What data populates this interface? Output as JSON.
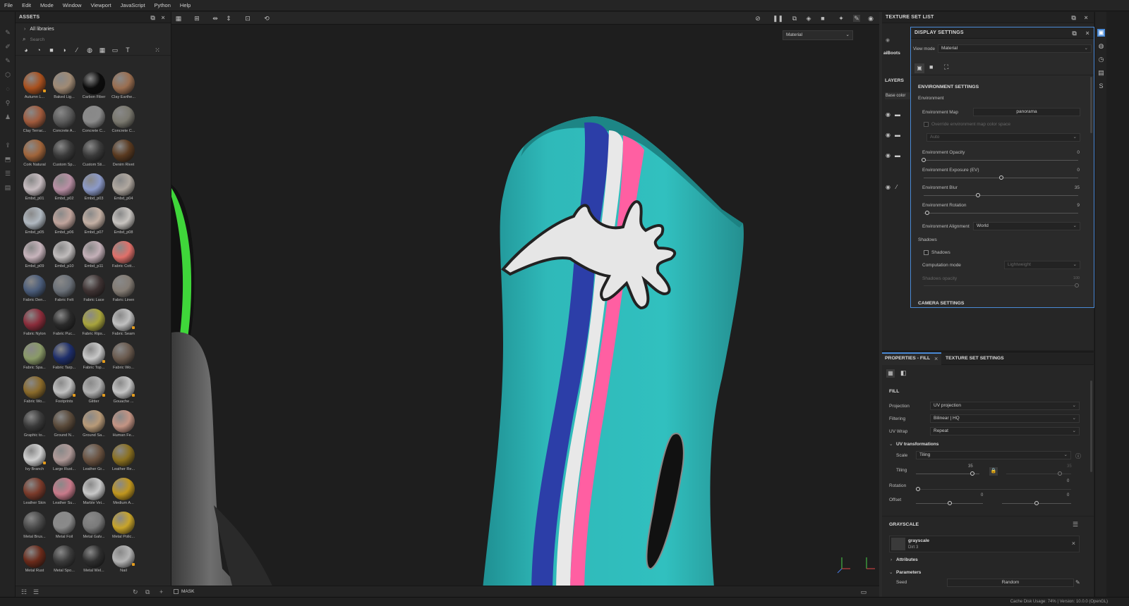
{
  "menu": [
    "File",
    "Edit",
    "Mode",
    "Window",
    "Viewport",
    "JavaScript",
    "Python",
    "Help"
  ],
  "assets": {
    "title": "ASSETS",
    "library": "All libraries",
    "search_placeholder": "Search",
    "items": [
      {
        "label": "Autumn L...",
        "color": "#a8501e",
        "badge": true
      },
      {
        "label": "Baked Lig...",
        "color": "#a08a74",
        "badge": false
      },
      {
        "label": "Carbon Fiber",
        "color": "#0c0c0c",
        "badge": false
      },
      {
        "label": "Clay Earthe...",
        "color": "#9a6e50",
        "badge": false
      },
      {
        "label": "Clay Terrac...",
        "color": "#a05a3c",
        "badge": false
      },
      {
        "label": "Concrete A...",
        "color": "#5a5a5a",
        "badge": false
      },
      {
        "label": "Concrete C...",
        "color": "#8a8a8a",
        "badge": false
      },
      {
        "label": "Concrete C...",
        "color": "#7a786e",
        "badge": false
      },
      {
        "label": "Cork Natural",
        "color": "#a0643a",
        "badge": false
      },
      {
        "label": "Custom Sp...",
        "color": "#3a3a3a",
        "badge": false
      },
      {
        "label": "Custom Sti...",
        "color": "#3a3a3a",
        "badge": false
      },
      {
        "label": "Denim Rivet",
        "color": "#5a3a20",
        "badge": false
      },
      {
        "label": "Embd_p01",
        "color": "#c7bcc0",
        "badge": false
      },
      {
        "label": "Embd_p02",
        "color": "#b88fa4",
        "badge": false
      },
      {
        "label": "Embd_p03",
        "color": "#8c9ac8",
        "badge": false
      },
      {
        "label": "Embd_p04",
        "color": "#b0a8a0",
        "badge": false
      },
      {
        "label": "Embd_p05",
        "color": "#b0b8c0",
        "badge": false
      },
      {
        "label": "Embd_p06",
        "color": "#c0a49c",
        "badge": false
      },
      {
        "label": "Embd_p07",
        "color": "#c4b0a4",
        "badge": false
      },
      {
        "label": "Embd_p08",
        "color": "#c8c4c0",
        "badge": false
      },
      {
        "label": "Embd_p09",
        "color": "#c8b4bc",
        "badge": false
      },
      {
        "label": "Embd_p10",
        "color": "#c0bcbc",
        "badge": false
      },
      {
        "label": "Embd_p11",
        "color": "#c4b0b8",
        "badge": false
      },
      {
        "label": "Fabric Cott...",
        "color": "#e0706a",
        "badge": false
      },
      {
        "label": "Fabric Den...",
        "color": "#4a5c7a",
        "badge": false
      },
      {
        "label": "Fabric Felt",
        "color": "#6a7078",
        "badge": false
      },
      {
        "label": "Fabric Lace",
        "color": "#3e3232",
        "badge": false
      },
      {
        "label": "Fabric Linen",
        "color": "#847c74",
        "badge": false
      },
      {
        "label": "Fabric Nylon",
        "color": "#8a2c3a",
        "badge": false
      },
      {
        "label": "Fabric Puc...",
        "color": "#2a2a2a",
        "badge": false
      },
      {
        "label": "Fabric Rips...",
        "color": "#a8a43c",
        "badge": false
      },
      {
        "label": "Fabric Seam",
        "color": "#c0c0c0",
        "badge": true
      },
      {
        "label": "Fabric Spa...",
        "color": "#8a9a68",
        "badge": false
      },
      {
        "label": "Fabric Tarp...",
        "color": "#1e2e6a",
        "badge": false
      },
      {
        "label": "Fabric Top...",
        "color": "#c8c8c8",
        "badge": true
      },
      {
        "label": "Fabric Wo...",
        "color": "#6a5a4e",
        "badge": false
      },
      {
        "label": "Fabric Wo...",
        "color": "#8a6a2a",
        "badge": false
      },
      {
        "label": "Footprints",
        "color": "#c0c0c0",
        "badge": true
      },
      {
        "label": "Glitter",
        "color": "#b0b0b0",
        "badge": true
      },
      {
        "label": "Gouache ...",
        "color": "#c4c4c4",
        "badge": true
      },
      {
        "label": "Graphic to...",
        "color": "#3a3a3a",
        "badge": false
      },
      {
        "label": "Ground N...",
        "color": "#5a4a3a",
        "badge": false
      },
      {
        "label": "Ground Sa...",
        "color": "#b89a78",
        "badge": false
      },
      {
        "label": "Human Fe...",
        "color": "#c49484",
        "badge": false
      },
      {
        "label": "Ivy Branch",
        "color": "#d0d0d0",
        "badge": true
      },
      {
        "label": "Large Rust...",
        "color": "#b09a98",
        "badge": false
      },
      {
        "label": "Leather Gr...",
        "color": "#6a5240",
        "badge": false
      },
      {
        "label": "Leather Re...",
        "color": "#8a7020",
        "badge": false
      },
      {
        "label": "Leather Skin",
        "color": "#7a3a2a",
        "badge": false
      },
      {
        "label": "Leather Su...",
        "color": "#c87a8a",
        "badge": false
      },
      {
        "label": "Marble Vei...",
        "color": "#c8c8c8",
        "badge": false
      },
      {
        "label": "Medium A...",
        "color": "#c0961e",
        "badge": false
      },
      {
        "label": "Metal Brus...",
        "color": "#4a4a4a",
        "badge": false
      },
      {
        "label": "Metal Foil",
        "color": "#8a8a8a",
        "badge": false
      },
      {
        "label": "Metal Galv...",
        "color": "#7a7a7a",
        "badge": false
      },
      {
        "label": "Metal Polic...",
        "color": "#c8a42a",
        "badge": false
      },
      {
        "label": "Metal Rust",
        "color": "#6a2a1a",
        "badge": false
      },
      {
        "label": "Metal Spo...",
        "color": "#3a3a3a",
        "badge": false
      },
      {
        "label": "Metal Wel...",
        "color": "#2e2e2e",
        "badge": false
      },
      {
        "label": "Nail",
        "color": "#b4b4b4",
        "badge": true
      }
    ]
  },
  "viewport": {
    "mode": "Material",
    "mask_label": "MASK"
  },
  "texture_set_list": {
    "title": "TEXTURE SET LIST",
    "item": "aiBoots",
    "layers_label": "LAYERS",
    "channel": "Base color"
  },
  "display_settings": {
    "title": "DISPLAY SETTINGS",
    "view_mode_label": "View mode",
    "view_mode": "Material",
    "env_section": "ENVIRONMENT SETTINGS",
    "environment": "Environment",
    "env_map_label": "Environment Map",
    "env_map": "panorama",
    "override_label": "Override environment map color space",
    "auto": "Auto",
    "opacity_label": "Environment Opacity",
    "opacity_value": "0",
    "opacity_frac": 0.0,
    "exposure_label": "Environment Exposure (EV)",
    "exposure_value": "0",
    "exposure_frac": 0.5,
    "blur_label": "Environment Blur",
    "blur_value": "35",
    "blur_frac": 0.35,
    "rotation_label": "Environment Rotation",
    "rotation_value": "9",
    "rotation_frac": 0.025,
    "alignment_label": "Environment Alignment",
    "alignment": "World",
    "shadows_title": "Shadows",
    "shadows_label": "Shadows",
    "computation_label": "Computation mode",
    "computation": "Lightweight",
    "shadows_opacity_label": "Shadows opacity",
    "shadows_opacity_value": "100",
    "camera_section": "CAMERA SETTINGS"
  },
  "properties": {
    "tab_fill": "PROPERTIES - FILL",
    "tab_texset": "TEXTURE SET SETTINGS",
    "fill": "FILL",
    "projection_label": "Projection",
    "projection": "UV projection",
    "filtering_label": "Filtering",
    "filtering": "Bilinear | HQ",
    "uvwrap_label": "UV Wrap",
    "uvwrap": "Repeat",
    "uvtrans": "UV transformations",
    "scale_label": "Scale",
    "scale": "Tiling",
    "tiling_label": "Tiling",
    "tiling_value": "35",
    "tiling_value2": "35",
    "rotation_label": "Rotation",
    "rotation_value": "0",
    "offset_label": "Offset",
    "offset_value": "0",
    "offset_value2": "0",
    "grayscale": "GRAYSCALE",
    "gs_name": "grayscale",
    "gs_sub": "Dirt 3",
    "attributes": "Attributes",
    "parameters": "Parameters",
    "seed_label": "Seed",
    "seed": "Random"
  },
  "status": "Cache Disk Usage:  74% | Version: 10.0.0 (OpenGL)",
  "colors": {
    "accent": "#4a8ad6",
    "boot": "#2fb9b9",
    "stripe_blue": "#2c3ea8",
    "stripe_pink": "#ff5fa2"
  }
}
